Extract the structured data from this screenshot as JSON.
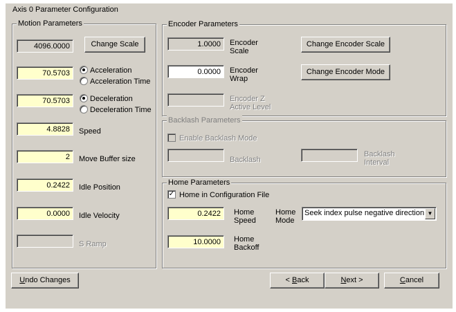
{
  "window": {
    "title": "Axis 0 Parameter Configuration"
  },
  "motion": {
    "legend": "Motion Parameters",
    "scale_value": "4096.0000",
    "change_scale_label": "Change Scale",
    "accel_value": "70.5703",
    "accel_options": [
      "Acceleration",
      "Acceleration Time"
    ],
    "decel_value": "70.5703",
    "decel_options": [
      "Deceleration",
      "Deceleration Time"
    ],
    "speed_value": "4.8828",
    "speed_label": "Speed",
    "move_buffer_value": "2",
    "move_buffer_label": "Move Buffer size",
    "idle_position_value": "0.2422",
    "idle_position_label": "Idle Position",
    "idle_velocity_value": "0.0000",
    "idle_velocity_label": "Idle Velocity",
    "s_ramp_label": "S Ramp"
  },
  "encoder": {
    "legend": "Encoder Parameters",
    "scale_value": "1.0000",
    "scale_label_1": "Encoder",
    "scale_label_2": "Scale",
    "wrap_value": "0.0000",
    "wrap_label_1": "Encoder",
    "wrap_label_2": "Wrap",
    "z_label_1": "Encoder Z",
    "z_label_2": "Active Level",
    "change_scale_label": "Change Encoder Scale",
    "change_mode_label": "Change Encoder Mode"
  },
  "backlash": {
    "legend": "Backlash Parameters",
    "enable_label": "Enable Backlash Mode",
    "backlash_label": "Backlash",
    "interval_label_1": "Backlash",
    "interval_label_2": "Interval"
  },
  "home": {
    "legend": "Home Parameters",
    "in_config_label": "Home in Configuration File",
    "speed_value": "0.2422",
    "speed_label_1": "Home",
    "speed_label_2": "Speed",
    "mode_label_1": "Home",
    "mode_label_2": "Mode",
    "mode_selected": "Seek index pulse negative direction.",
    "backoff_value": "10.0000",
    "backoff_label_1": "Home",
    "backoff_label_2": "Backoff"
  },
  "buttons": {
    "undo_first": "U",
    "undo_rest": "ndo Changes",
    "back_prefix": "< ",
    "back_mnem": "B",
    "back_rest": "ack",
    "next_mnem": "N",
    "next_rest": "ext >",
    "cancel_mnem": "C",
    "cancel_rest": "ancel"
  }
}
